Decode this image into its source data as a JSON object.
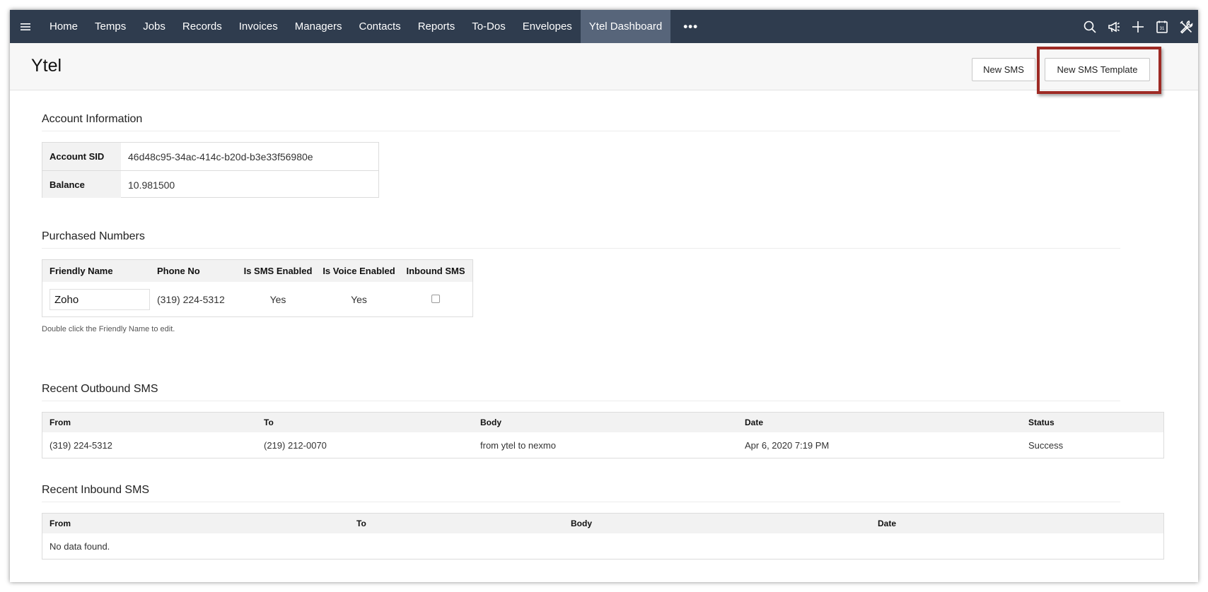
{
  "nav": {
    "menu_icon": "hamburger-icon",
    "items": [
      {
        "label": "Home"
      },
      {
        "label": "Temps"
      },
      {
        "label": "Jobs"
      },
      {
        "label": "Records"
      },
      {
        "label": "Invoices"
      },
      {
        "label": "Managers"
      },
      {
        "label": "Contacts"
      },
      {
        "label": "Reports"
      },
      {
        "label": "To-Dos"
      },
      {
        "label": "Envelopes"
      },
      {
        "label": "Ytel Dashboard"
      }
    ],
    "more_label": "•••",
    "calendar_day": "31",
    "right_icons": [
      "search-icon",
      "megaphone-icon",
      "plus-icon",
      "calendar-icon",
      "tools-icon"
    ],
    "bg_color": "#2f3c4e",
    "active_color": "#57657a"
  },
  "header": {
    "title": "Ytel",
    "new_sms_label": "New SMS",
    "new_template_label": "New SMS Template",
    "highlight_color": "#9e2b25"
  },
  "account": {
    "title": "Account Information",
    "rows": [
      {
        "label": "Account SID",
        "value": "46d48c95-34ac-414c-b20d-b3e33f56980e"
      },
      {
        "label": "Balance",
        "value": "10.981500"
      }
    ]
  },
  "numbers": {
    "title": "Purchased Numbers",
    "headers": [
      "Friendly Name",
      "Phone No",
      "Is SMS Enabled",
      "Is Voice Enabled",
      "Inbound SMS"
    ],
    "row": {
      "friendly_name": "Zoho",
      "phone": "(319) 224-5312",
      "sms_enabled": "Yes",
      "voice_enabled": "Yes",
      "inbound_sms_checked": false
    },
    "hint": "Double click the Friendly Name to edit."
  },
  "outbound": {
    "title": "Recent Outbound SMS",
    "headers": [
      "From",
      "To",
      "Body",
      "Date",
      "Status"
    ],
    "rows": [
      {
        "from": "(319) 224-5312",
        "to": "(219) 212-0070",
        "body": "from ytel to nexmo",
        "date": "Apr 6, 2020 7:19 PM",
        "status": "Success"
      }
    ]
  },
  "inbound": {
    "title": "Recent Inbound SMS",
    "headers": [
      "From",
      "To",
      "Body",
      "Date"
    ],
    "empty_text": "No data found."
  }
}
